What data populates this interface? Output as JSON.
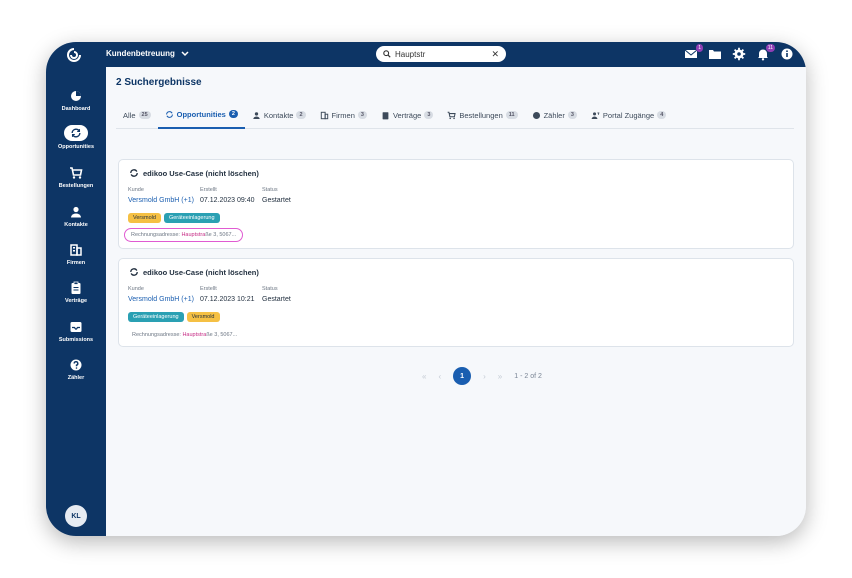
{
  "header": {
    "app_title": "Kundenbetreuung",
    "search_value": "Hauptstr",
    "mail_badge": "1",
    "bell_badge": "11"
  },
  "sidebar": {
    "items": [
      {
        "label": "Dashboard",
        "icon": "pie-chart-icon"
      },
      {
        "label": "Opportunities",
        "icon": "refresh-icon"
      },
      {
        "label": "Bestellungen",
        "icon": "cart-icon"
      },
      {
        "label": "Kontakte",
        "icon": "person-icon"
      },
      {
        "label": "Firmen",
        "icon": "building-icon"
      },
      {
        "label": "Verträge",
        "icon": "clipboard-icon"
      },
      {
        "label": "Submissions",
        "icon": "inbox-icon"
      },
      {
        "label": "Zähler",
        "icon": "help-icon"
      }
    ],
    "avatar": "KL"
  },
  "main": {
    "results_title": "2 Suchergebnisse",
    "tabs": [
      {
        "label": "Alle",
        "count": "25"
      },
      {
        "label": "Opportunities",
        "count": "2"
      },
      {
        "label": "Kontakte",
        "count": "2"
      },
      {
        "label": "Firmen",
        "count": "3"
      },
      {
        "label": "Verträge",
        "count": "3"
      },
      {
        "label": "Bestellungen",
        "count": "11"
      },
      {
        "label": "Zähler",
        "count": "3"
      },
      {
        "label": "Portal Zugänge",
        "count": "4"
      }
    ],
    "results": [
      {
        "title": "edikoo Use-Case (nicht löschen)",
        "labels": {
          "kunde": "Kunde",
          "erstellt": "Erstellt",
          "status": "Status"
        },
        "kunde": "Versmold GmbH (+1)",
        "erstellt": "07.12.2023 09:40",
        "status": "Gestartet",
        "tags": [
          "Versmold",
          "Geräteeinlagerung"
        ],
        "addr_label": "Rechnungsadresse:",
        "addr_highlight": "Hauptstra",
        "addr_rest": "ße 3, 5067..."
      },
      {
        "title": "edikoo Use-Case (nicht löschen)",
        "labels": {
          "kunde": "Kunde",
          "erstellt": "Erstellt",
          "status": "Status"
        },
        "kunde": "Versmold GmbH (+1)",
        "erstellt": "07.12.2023 10:21",
        "status": "Gestartet",
        "tags": [
          "Geräteeinlagerung",
          "Versmold"
        ],
        "addr_label": "Rechnungsadresse:",
        "addr_highlight": "Hauptstra",
        "addr_rest": "ße 3, 5067..."
      }
    ],
    "pagination": {
      "current": "1",
      "range": "1 - 2 of 2"
    }
  },
  "colors": {
    "brand": "#0d3565",
    "accent": "#1a5eb0",
    "tag_yellow": "#f5c044",
    "tag_teal": "#2aa0b3",
    "highlight_ring": "#e05bd2"
  }
}
